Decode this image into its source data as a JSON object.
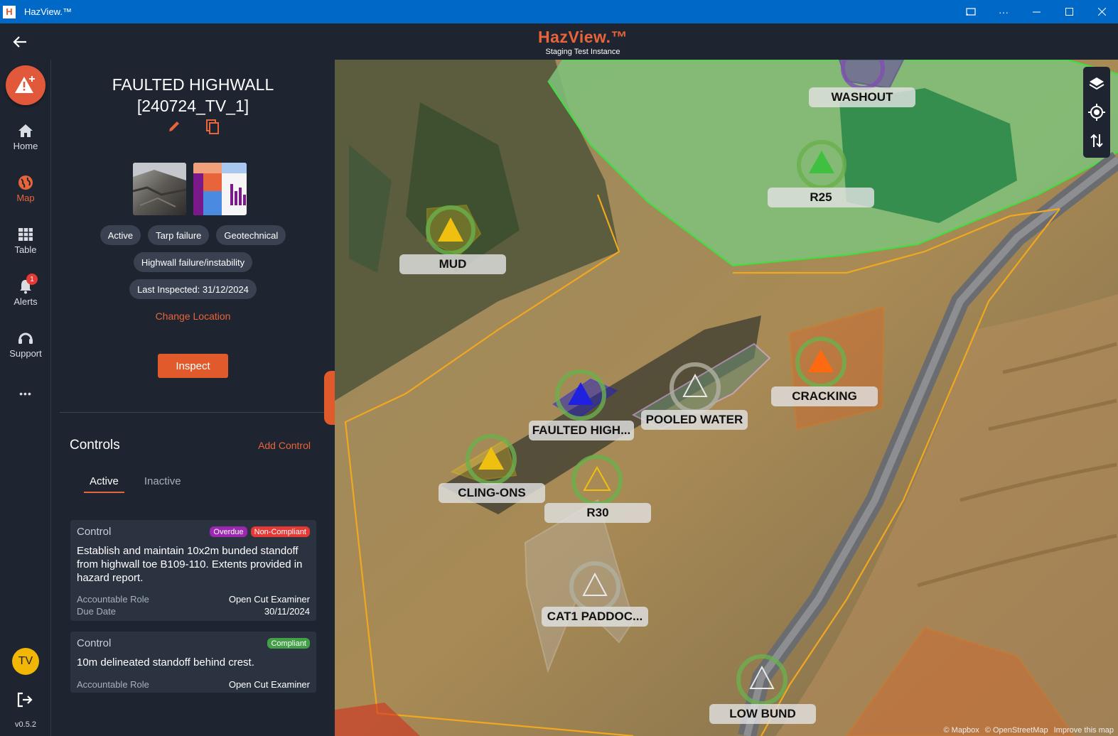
{
  "window": {
    "title": "HazView.™"
  },
  "header": {
    "brand": "HazView.™",
    "instance": "Staging Test Instance"
  },
  "nav": {
    "items": [
      {
        "label": "Home"
      },
      {
        "label": "Map"
      },
      {
        "label": "Table"
      },
      {
        "label": "Alerts",
        "badge": "1"
      },
      {
        "label": "Support"
      }
    ],
    "more": "•••",
    "avatar": "TV",
    "version": "v0.5.2"
  },
  "hazard": {
    "title_line1": "FAULTED HIGHWALL",
    "title_line2": "[240724_TV_1]",
    "chips_row1": [
      "Active",
      "Tarp failure",
      "Geotechnical"
    ],
    "chip_category": "Highwall failure/instability",
    "last_inspected": "Last Inspected: 31/12/2024",
    "change_location": "Change Location",
    "inspect_label": "Inspect"
  },
  "controls": {
    "title": "Controls",
    "add_label": "Add Control",
    "tabs": [
      "Active",
      "Inactive"
    ],
    "cards": [
      {
        "heading": "Control",
        "tags": [
          {
            "text": "Overdue",
            "color": "#9c27b0"
          },
          {
            "text": "Non-Compliant",
            "color": "#e53935"
          }
        ],
        "description": "Establish and maintain 10x2m bunded standoff from highwall toe B109-110. Extents provided in hazard report.",
        "role_label": "Accountable Role",
        "role_value": "Open Cut Examiner",
        "due_label": "Due Date",
        "due_value": "30/11/2024"
      },
      {
        "heading": "Control",
        "tags": [
          {
            "text": "Compliant",
            "color": "#43a047"
          }
        ],
        "description": "10m delineated standoff behind crest.",
        "role_label": "Accountable Role",
        "role_value": "Open Cut Examiner"
      }
    ]
  },
  "map": {
    "labels": [
      "WASHOUT",
      "R25",
      "MUD",
      "CRACKING",
      "POOLED WATER",
      "FAULTED HIGH...",
      "CLING-ONS",
      "R30",
      "CAT1 PADDOC...",
      "LOW BUND"
    ],
    "attribution": [
      "© Mapbox",
      "© OpenStreetMap",
      "Improve this map"
    ]
  },
  "colors": {
    "accent": "#e8643a",
    "panel": "#1e2530",
    "titlebar": "#0068c7"
  }
}
